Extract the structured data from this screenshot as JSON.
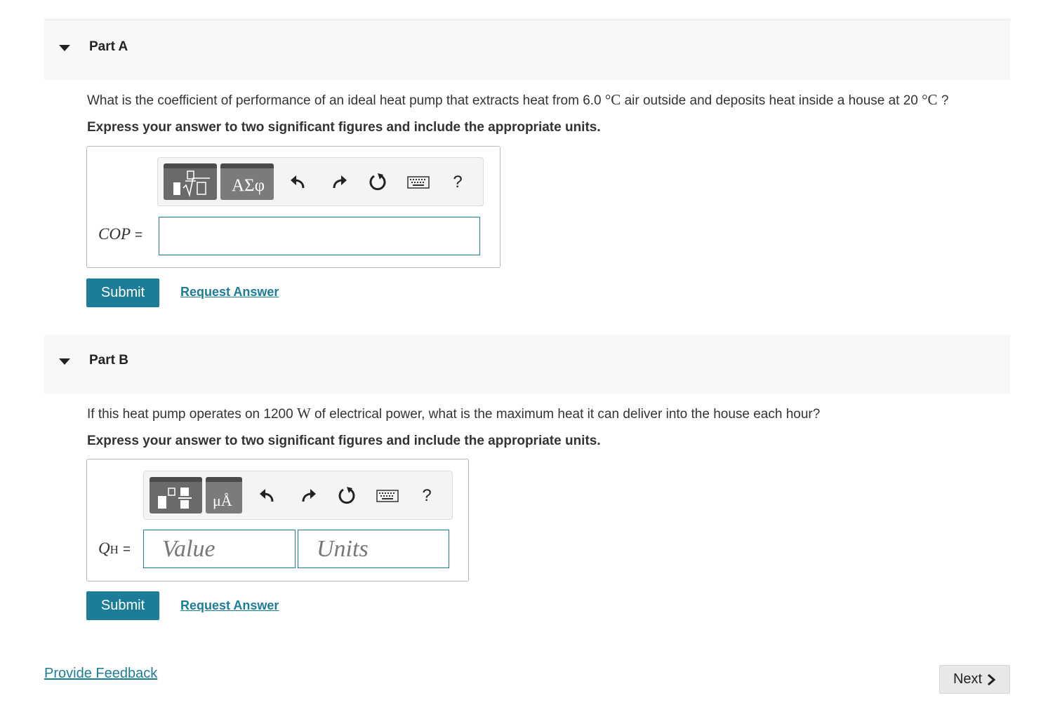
{
  "partA": {
    "title": "Part A",
    "question_pre": "What is the coefficient of performance of an ideal heat pump that extracts heat from 6.0 ",
    "question_unit1": "°C",
    "question_mid": " air outside and deposits heat inside a house at 20 ",
    "question_unit2": "°C",
    "question_post": " ?",
    "instruction": "Express your answer to two significant figures and include the appropriate units.",
    "toolbar": {
      "greek_label": "ΑΣφ",
      "help_label": "?"
    },
    "var_label": "COP",
    "eq": "=",
    "input_value": "",
    "submit_label": "Submit",
    "request_label": "Request Answer"
  },
  "partB": {
    "title": "Part B",
    "question_pre": "If this heat pump operates on 1200 ",
    "question_unit": "W",
    "question_post": " of electrical power, what is the maximum heat it can deliver into the house each hour?",
    "instruction": "Express your answer to two significant figures and include the appropriate units.",
    "toolbar": {
      "units_label": "μÅ",
      "help_label": "?"
    },
    "var_label": "Q",
    "var_sub": "H",
    "eq": "=",
    "value_placeholder": "Value",
    "units_placeholder": "Units",
    "submit_label": "Submit",
    "request_label": "Request Answer"
  },
  "footer": {
    "feedback_label": "Provide Feedback",
    "next_label": "Next",
    "next_icon": "chevron-right-icon"
  },
  "colors": {
    "accent": "#1c7d98",
    "header_bg": "#f7f7f7",
    "tool_button": "#6a6a6a"
  }
}
